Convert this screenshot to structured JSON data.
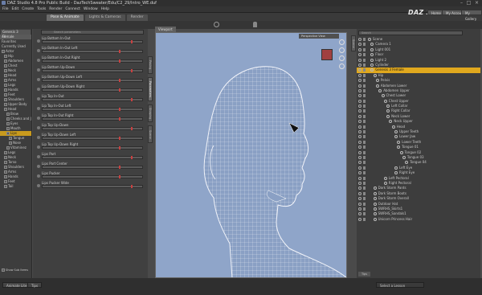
{
  "window": {
    "title": "DAZ Studio 4.8 Pro Public Build - DazTechSweater/Edu/C2_29/Intro_WE.duf"
  },
  "menu": [
    "File",
    "Edit",
    "Create",
    "Tools",
    "Render",
    "Connect",
    "Window",
    "Help"
  ],
  "tabs": [
    {
      "label": "Pose & Animate",
      "active": true
    },
    {
      "label": "Lights & Cameras",
      "active": false
    },
    {
      "label": "Render",
      "active": false
    }
  ],
  "header": {
    "logo": "DAZ 3D",
    "home": "Home",
    "account": "My Account",
    "gallery": "My Gallery"
  },
  "left": {
    "header": "Genesis 3 Female",
    "filters": [
      "All",
      "Favorites",
      "Currently Used"
    ],
    "tree": [
      "Actor",
      "Hip",
      "Abdomen",
      "Chest",
      "Neck",
      "Head",
      "Arms",
      "Legs",
      "Hands",
      "Feet",
      "Shoulders",
      "Upper Body",
      "Head",
      "Brow",
      "Cheeks and Jaw",
      "Eyes",
      "Mouth",
      "Lips",
      "Tongue",
      "Nose",
      "Vitaminez",
      "Legs",
      "Neck",
      "Torso",
      "Shoulders",
      "Arms",
      "Hands",
      "Feet",
      "Tail"
    ],
    "selected": "Lips",
    "footer": "Show Sub Items"
  },
  "params": {
    "search": "Search parameters",
    "items": [
      "Lip Bottom In-Out",
      "Lip Bottom In-Out Left",
      "Lip Bottom In-Out Right",
      "Lip Bottom Up-Down",
      "Lip Bottom Up-Down Left",
      "Lip Bottom Up-Down Right",
      "Lip Top In-Out",
      "Lip Top In-Out Left",
      "Lip Top In-Out Right",
      "Lip Top Up-Down",
      "Lip Top Up-Down Left",
      "Lip Top Up-Down Right",
      "Lips Part",
      "Lips Part Center",
      "Lips Pucker",
      "Lips Pucker Wide"
    ],
    "vtabs": [
      "Posing",
      "Parameters",
      "Shaping",
      "Scene"
    ]
  },
  "viewport": {
    "tab": "Viewport",
    "camera": "Perspective View"
  },
  "scene": {
    "search": "Search",
    "rows": [
      {
        "label": "Scene",
        "depth": 0
      },
      {
        "label": "Camera 1",
        "depth": 1
      },
      {
        "label": "Light 001",
        "depth": 1
      },
      {
        "label": "Floor",
        "depth": 1
      },
      {
        "label": "Light 2",
        "depth": 1
      },
      {
        "label": "Cylinder",
        "depth": 1
      },
      {
        "label": "Genesis 3 Female",
        "depth": 1,
        "selected": true
      },
      {
        "label": "Hip",
        "depth": 2
      },
      {
        "label": "Pelvis",
        "depth": 3
      },
      {
        "label": "Abdomen Lower",
        "depth": 3
      },
      {
        "label": "Abdomen Upper",
        "depth": 4
      },
      {
        "label": "Chest Lower",
        "depth": 5
      },
      {
        "label": "Chest Upper",
        "depth": 6
      },
      {
        "label": "Left Collar",
        "depth": 7
      },
      {
        "label": "Right Collar",
        "depth": 7
      },
      {
        "label": "Neck Lower",
        "depth": 7
      },
      {
        "label": "Neck Upper",
        "depth": 8
      },
      {
        "label": "Head",
        "depth": 9
      },
      {
        "label": "Upper Teeth",
        "depth": 10
      },
      {
        "label": "Lower Jaw",
        "depth": 10
      },
      {
        "label": "Lower Teeth",
        "depth": 11
      },
      {
        "label": "Tongue 01",
        "depth": 11
      },
      {
        "label": "Tongue 02",
        "depth": 12
      },
      {
        "label": "Tongue 03",
        "depth": 13
      },
      {
        "label": "Tongue 04",
        "depth": 14
      },
      {
        "label": "Left Eye",
        "depth": 10
      },
      {
        "label": "Right Eye",
        "depth": 10
      },
      {
        "label": "Left Pectoral",
        "depth": 6
      },
      {
        "label": "Right Pectoral",
        "depth": 6
      },
      {
        "label": "Dark Storm Pants",
        "depth": 2
      },
      {
        "label": "Dark Storm Boots",
        "depth": 2
      },
      {
        "label": "Dark Storm Overall",
        "depth": 2
      },
      {
        "label": "Outdoor Hat",
        "depth": 2
      },
      {
        "label": "SWRHS_Skirts1",
        "depth": 2
      },
      {
        "label": "SWRHS_Sandals1",
        "depth": 2
      },
      {
        "label": "Unicorn Princess Hair",
        "depth": 2
      }
    ],
    "bottom": "Tips"
  },
  "bottom": {
    "tabs": [
      "Animate Lite",
      "Tips"
    ],
    "search": "Select a Lesson"
  },
  "colors": {
    "accent": "#e0a81e",
    "viewport_bg": "#8fa5c9",
    "wire": "#ffffff"
  }
}
